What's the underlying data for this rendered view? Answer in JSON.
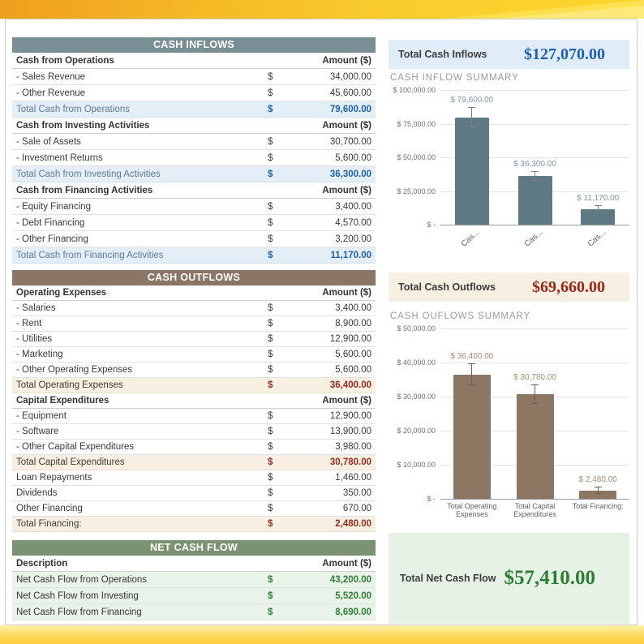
{
  "summary": {
    "inflows": {
      "label": "Total Cash Inflows",
      "value": "$127,070.00",
      "accent": "#1d5fae"
    },
    "outflows": {
      "label": "Total Cash Outflows",
      "value": "$69,660.00",
      "accent": "#99271c"
    },
    "net": {
      "label": "Total Net Cash Flow",
      "value": "$57,410.00",
      "accent": "#2e7d35"
    }
  },
  "tables": {
    "inflows": {
      "title": "CASH INFLOWS",
      "header_color": "#7a8e96",
      "rows": [
        {
          "type": "subheader",
          "label": "Cash from Operations",
          "amount_header": "Amount ($)"
        },
        {
          "type": "item",
          "label": "- Sales Revenue",
          "currency": "$",
          "amount": "34,000.00"
        },
        {
          "type": "item",
          "label": "- Other Revenue",
          "currency": "$",
          "amount": "45,600.00"
        },
        {
          "type": "total",
          "label": "Total Cash from Operations",
          "currency": "$",
          "amount": "79,600.00"
        },
        {
          "type": "subheader",
          "label": "Cash from Investing Activities",
          "amount_header": "Amount ($)"
        },
        {
          "type": "item",
          "label": "- Sale of Assets",
          "currency": "$",
          "amount": "30,700.00"
        },
        {
          "type": "item",
          "label": "- Investment Returns",
          "currency": "$",
          "amount": "5,600.00"
        },
        {
          "type": "total",
          "label": "Total Cash from Investing Activities",
          "currency": "$",
          "amount": "36,300.00"
        },
        {
          "type": "subheader",
          "label": "Cash from Financing Activities",
          "amount_header": "Amount ($)"
        },
        {
          "type": "item",
          "label": "- Equity Financing",
          "currency": "$",
          "amount": "3,400.00"
        },
        {
          "type": "item",
          "label": "- Debt Financing",
          "currency": "$",
          "amount": "4,570.00"
        },
        {
          "type": "item",
          "label": "- Other Financing",
          "currency": "$",
          "amount": "3,200.00"
        },
        {
          "type": "total",
          "label": "Total Cash from Financing Activities",
          "currency": "$",
          "amount": "11,170.00"
        }
      ]
    },
    "outflows": {
      "title": "CASH OUTFLOWS",
      "header_color": "#8b7665",
      "rows": [
        {
          "type": "subheader",
          "label": "Operating Expenses",
          "amount_header": "Amount ($)"
        },
        {
          "type": "item",
          "label": "- Salaries",
          "currency": "$",
          "amount": "3,400.00"
        },
        {
          "type": "item",
          "label": "- Rent",
          "currency": "$",
          "amount": "8,900.00"
        },
        {
          "type": "item",
          "label": "- Utilities",
          "currency": "$",
          "amount": "12,900.00"
        },
        {
          "type": "item",
          "label": "- Marketing",
          "currency": "$",
          "amount": "5,600.00"
        },
        {
          "type": "item",
          "label": "- Other Operating Expenses",
          "currency": "$",
          "amount": "5,600.00"
        },
        {
          "type": "total",
          "label": "Total Operating Expenses",
          "currency": "$",
          "amount": "36,400.00"
        },
        {
          "type": "subheader",
          "label": "Capital Expenditures",
          "amount_header": "Amount ($)"
        },
        {
          "type": "item",
          "label": "- Equipment",
          "currency": "$",
          "amount": "12,900.00"
        },
        {
          "type": "item",
          "label": "- Software",
          "currency": "$",
          "amount": "13,900.00"
        },
        {
          "type": "item",
          "label": "- Other Capital Expenditures",
          "currency": "$",
          "amount": "3,980.00"
        },
        {
          "type": "total",
          "label": "Total Capital Expenditures",
          "currency": "$",
          "amount": "30,780.00"
        },
        {
          "type": "item",
          "label": "Loan Repayments",
          "currency": "$",
          "amount": "1,460.00"
        },
        {
          "type": "item",
          "label": "Dividends",
          "currency": "$",
          "amount": "350.00"
        },
        {
          "type": "item",
          "label": "Other Financing",
          "currency": "$",
          "amount": "670.00"
        },
        {
          "type": "total",
          "label": "Total Financing:",
          "currency": "$",
          "amount": "2,480.00"
        }
      ]
    },
    "net": {
      "title": "NET CASH FLOW",
      "header_color": "#7b9370",
      "rows": [
        {
          "type": "subheader",
          "label": "Description",
          "amount_header": "Amount ($)"
        },
        {
          "type": "net",
          "label": "Net Cash Flow from Operations",
          "currency": "$",
          "amount": "43,200.00"
        },
        {
          "type": "net",
          "label": "Net Cash Flow from Investing",
          "currency": "$",
          "amount": "5,520.00"
        },
        {
          "type": "net",
          "label": "Net Cash Flow from Financing",
          "currency": "$",
          "amount": "8,690.00"
        }
      ]
    }
  },
  "chart_data": [
    {
      "type": "bar",
      "title": "CASH INFLOW SUMMARY",
      "categories": [
        "Cas...",
        "Cas...",
        "Cas..."
      ],
      "values": [
        79600,
        36300,
        11170
      ],
      "data_labels": [
        "$ 79,600.00",
        "$ 36,300.00",
        "$ 11,170.00"
      ],
      "ytick_labels": [
        "$ 100,000.00",
        "$ 75,000.00",
        "$ 50,000.00",
        "$ 25,000.00",
        "$ -"
      ],
      "ylim": [
        0,
        100000
      ],
      "grid": true,
      "legend": "none",
      "error_bars": true,
      "bar_color": "#5d7a84",
      "data_label_color": "#7f98a8",
      "error_bar_color": "#7f7f7f",
      "x_labels_rotated": true
    },
    {
      "type": "bar",
      "title": "CASH OUFLOWS SUMMARY",
      "categories": [
        "Total Operating Expenses",
        "Total Capital Expenditures",
        "Total Financing:"
      ],
      "values": [
        36400,
        30780,
        2480
      ],
      "data_labels": [
        "$ 36,400.00",
        "$ 30,780.00",
        "$ 2,480.00"
      ],
      "ytick_labels": [
        "$ 50,000.00",
        "$ 40,000.00",
        "$ 30,000.00",
        "$ 20,000.00",
        "$ 10,000.00",
        "$ -"
      ],
      "ylim": [
        0,
        50000
      ],
      "grid": true,
      "legend": "none",
      "error_bars": true,
      "bar_color": "#8d7662",
      "data_label_color": "#a58c72",
      "error_bar_color": "#6e5f51",
      "x_labels_rotated": false
    }
  ]
}
